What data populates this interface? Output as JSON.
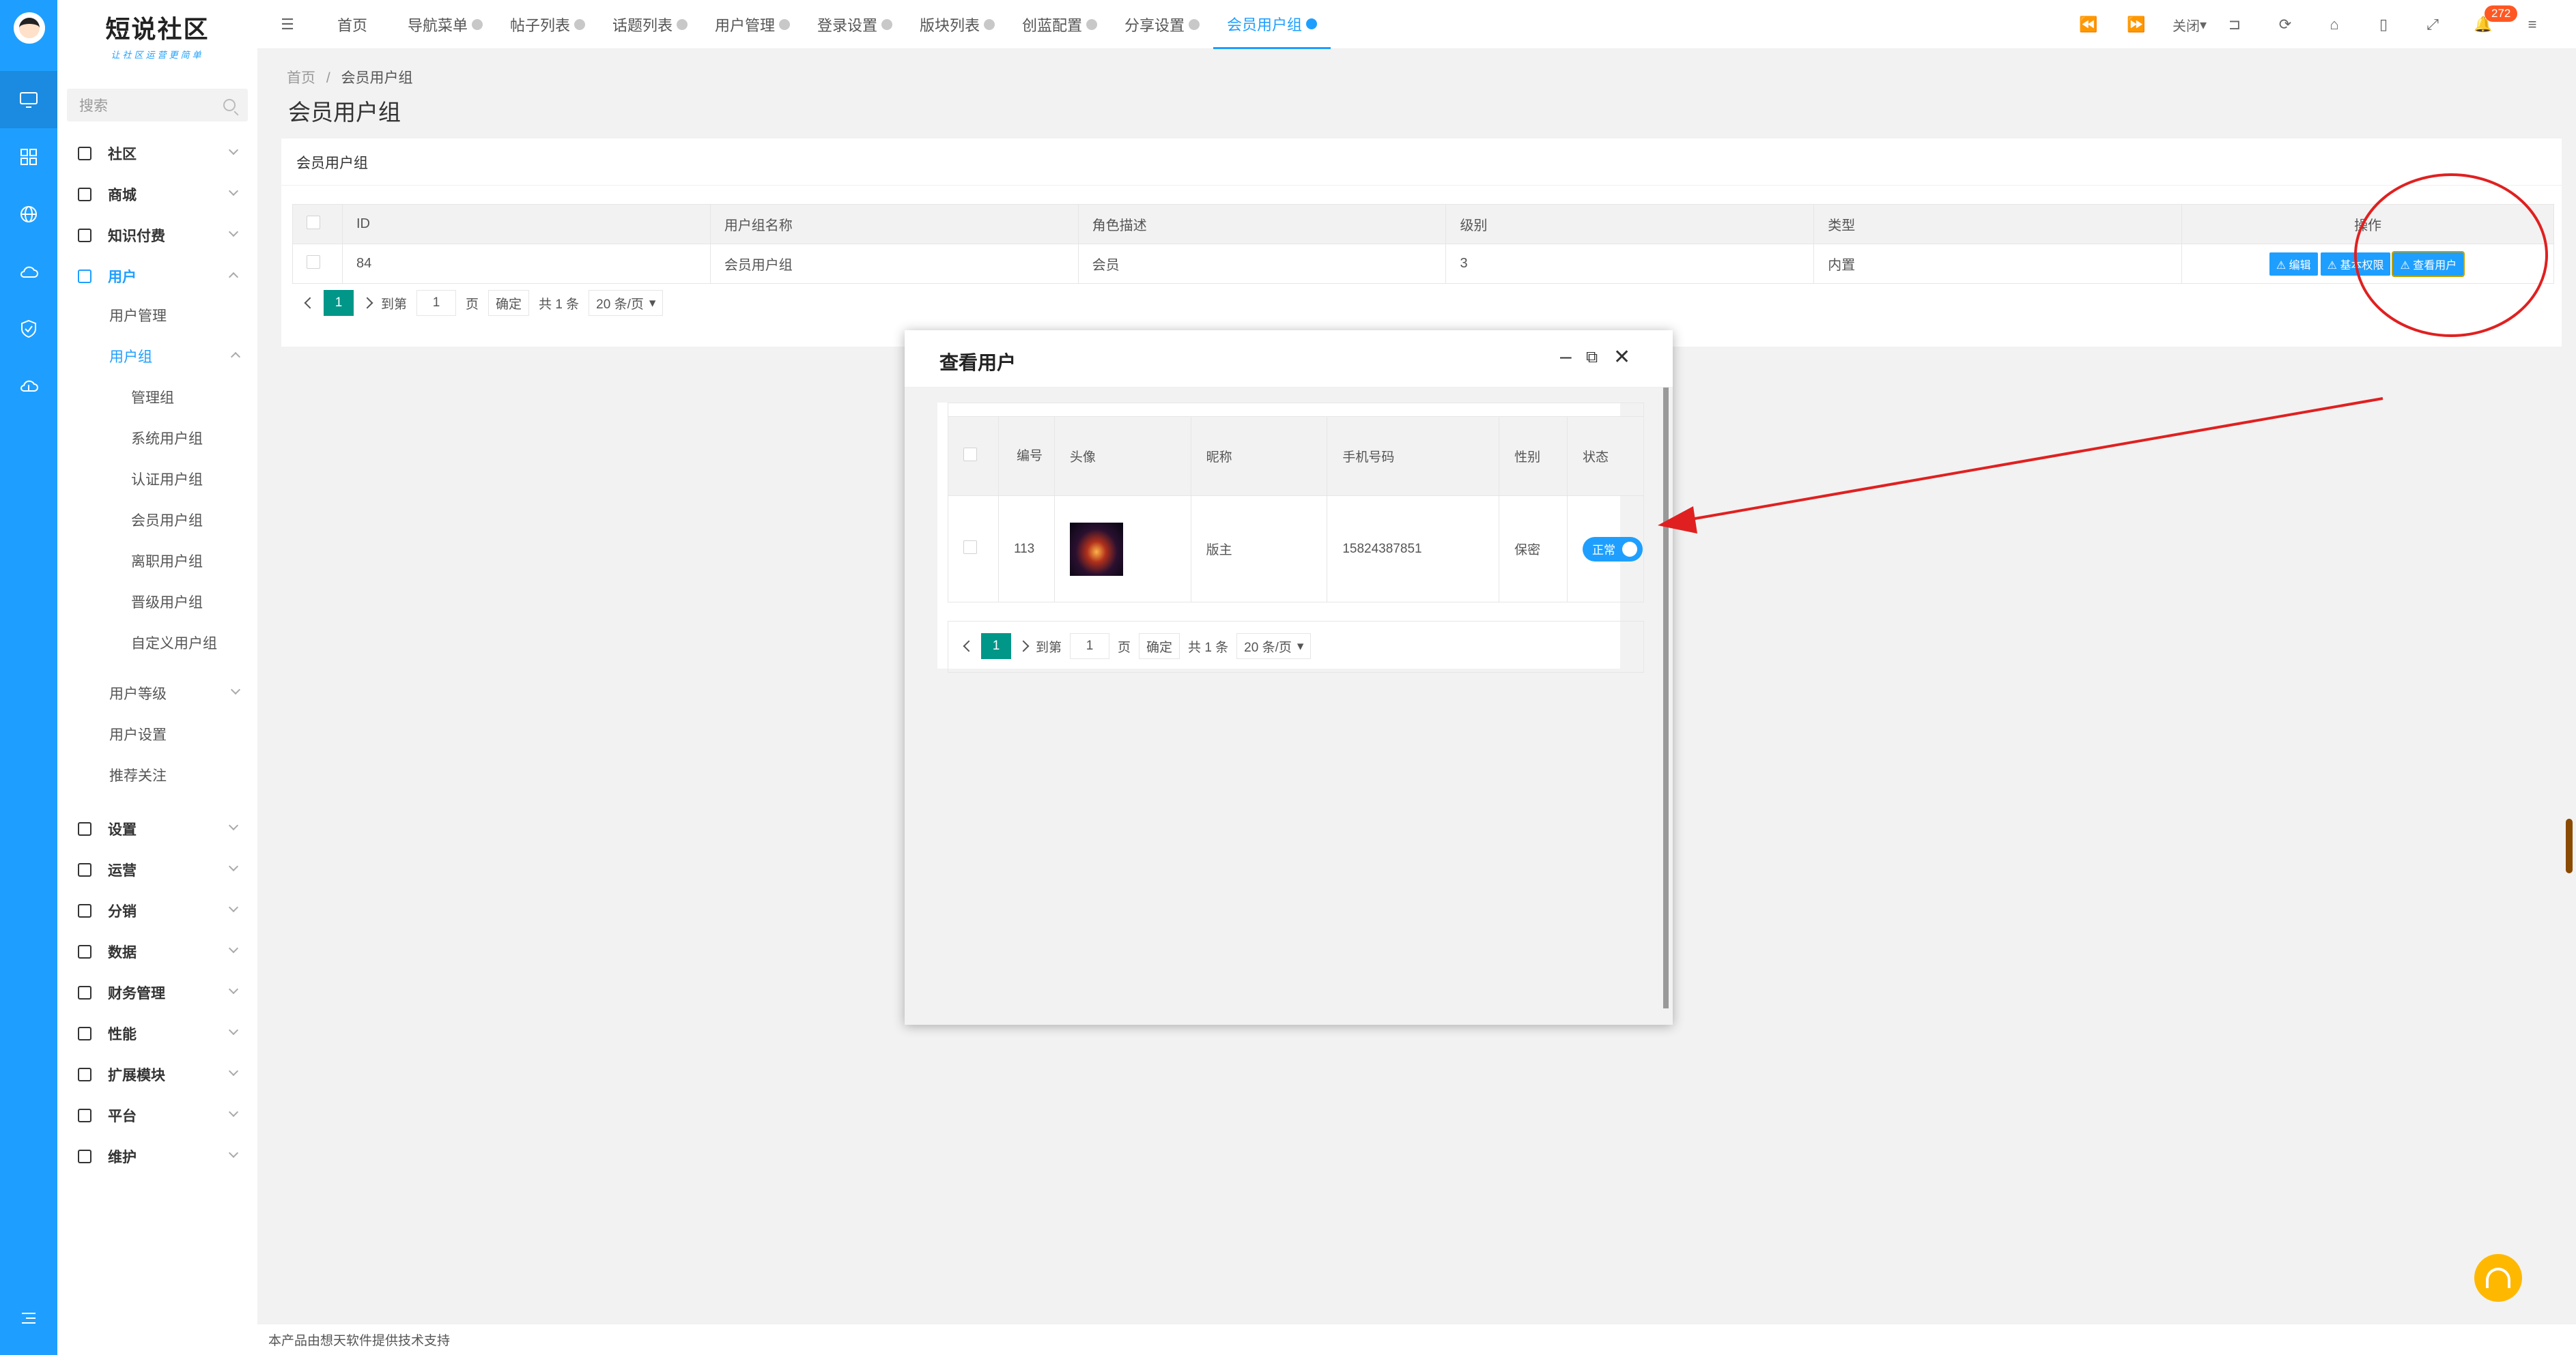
{
  "brand": {
    "name": "短说社区",
    "slogan": "让社区运营更简单"
  },
  "search": {
    "placeholder": "搜索"
  },
  "menu": {
    "community": "社区",
    "mall": "商城",
    "paid_knowledge": "知识付费",
    "user": "用户",
    "user_manage": "用户管理",
    "user_group": "用户组",
    "admin_group": "管理组",
    "system_group": "系统用户组",
    "cert_group": "认证用户组",
    "member_group": "会员用户组",
    "resign_group": "离职用户组",
    "promo_group": "晋级用户组",
    "custom_group": "自定义用户组",
    "user_level": "用户等级",
    "user_settings": "用户设置",
    "recommend_follow": "推荐关注",
    "settings": "设置",
    "operation": "运营",
    "distribution": "分销",
    "data": "数据",
    "finance": "财务管理",
    "performance": "性能",
    "extensions": "扩展模块",
    "platform": "平台",
    "maintenance": "维护"
  },
  "tabs": [
    "首页",
    "导航菜单",
    "帖子列表",
    "话题列表",
    "用户管理",
    "登录设置",
    "版块列表",
    "创蓝配置",
    "分享设置",
    "会员用户组"
  ],
  "toolbar": {
    "close_label": "关闭",
    "notification_count": "272"
  },
  "breadcrumb": {
    "home": "首页",
    "separator": "/",
    "current": "会员用户组"
  },
  "page_title": "会员用户组",
  "card_title": "会员用户组",
  "main_table": {
    "headers": [
      "ID",
      "用户组名称",
      "角色描述",
      "级别",
      "类型",
      "操作"
    ],
    "rows": [
      {
        "id": "84",
        "name": "会员用户组",
        "desc": "会员",
        "level": "3",
        "type": "内置"
      }
    ],
    "actions": [
      "编辑",
      "基本权限",
      "查看用户"
    ]
  },
  "pager": {
    "page": "1",
    "goto_label": "到第",
    "page_unit": "页",
    "confirm": "确定",
    "total": "共 1 条",
    "page_size": "20 条/页"
  },
  "modal": {
    "title": "查看用户",
    "headers": [
      "编号",
      "头像",
      "昵称",
      "手机号码",
      "性别",
      "状态"
    ],
    "rows": [
      {
        "id": "113",
        "nickname": "版主",
        "phone": "15824387851",
        "gender": "保密",
        "status": "正常"
      }
    ]
  },
  "footer": "本产品由想天软件提供技术支持",
  "colors": {
    "primary": "#1e9fff",
    "accent": "#009688",
    "annotation": "#e02020",
    "help": "#ffb800"
  }
}
